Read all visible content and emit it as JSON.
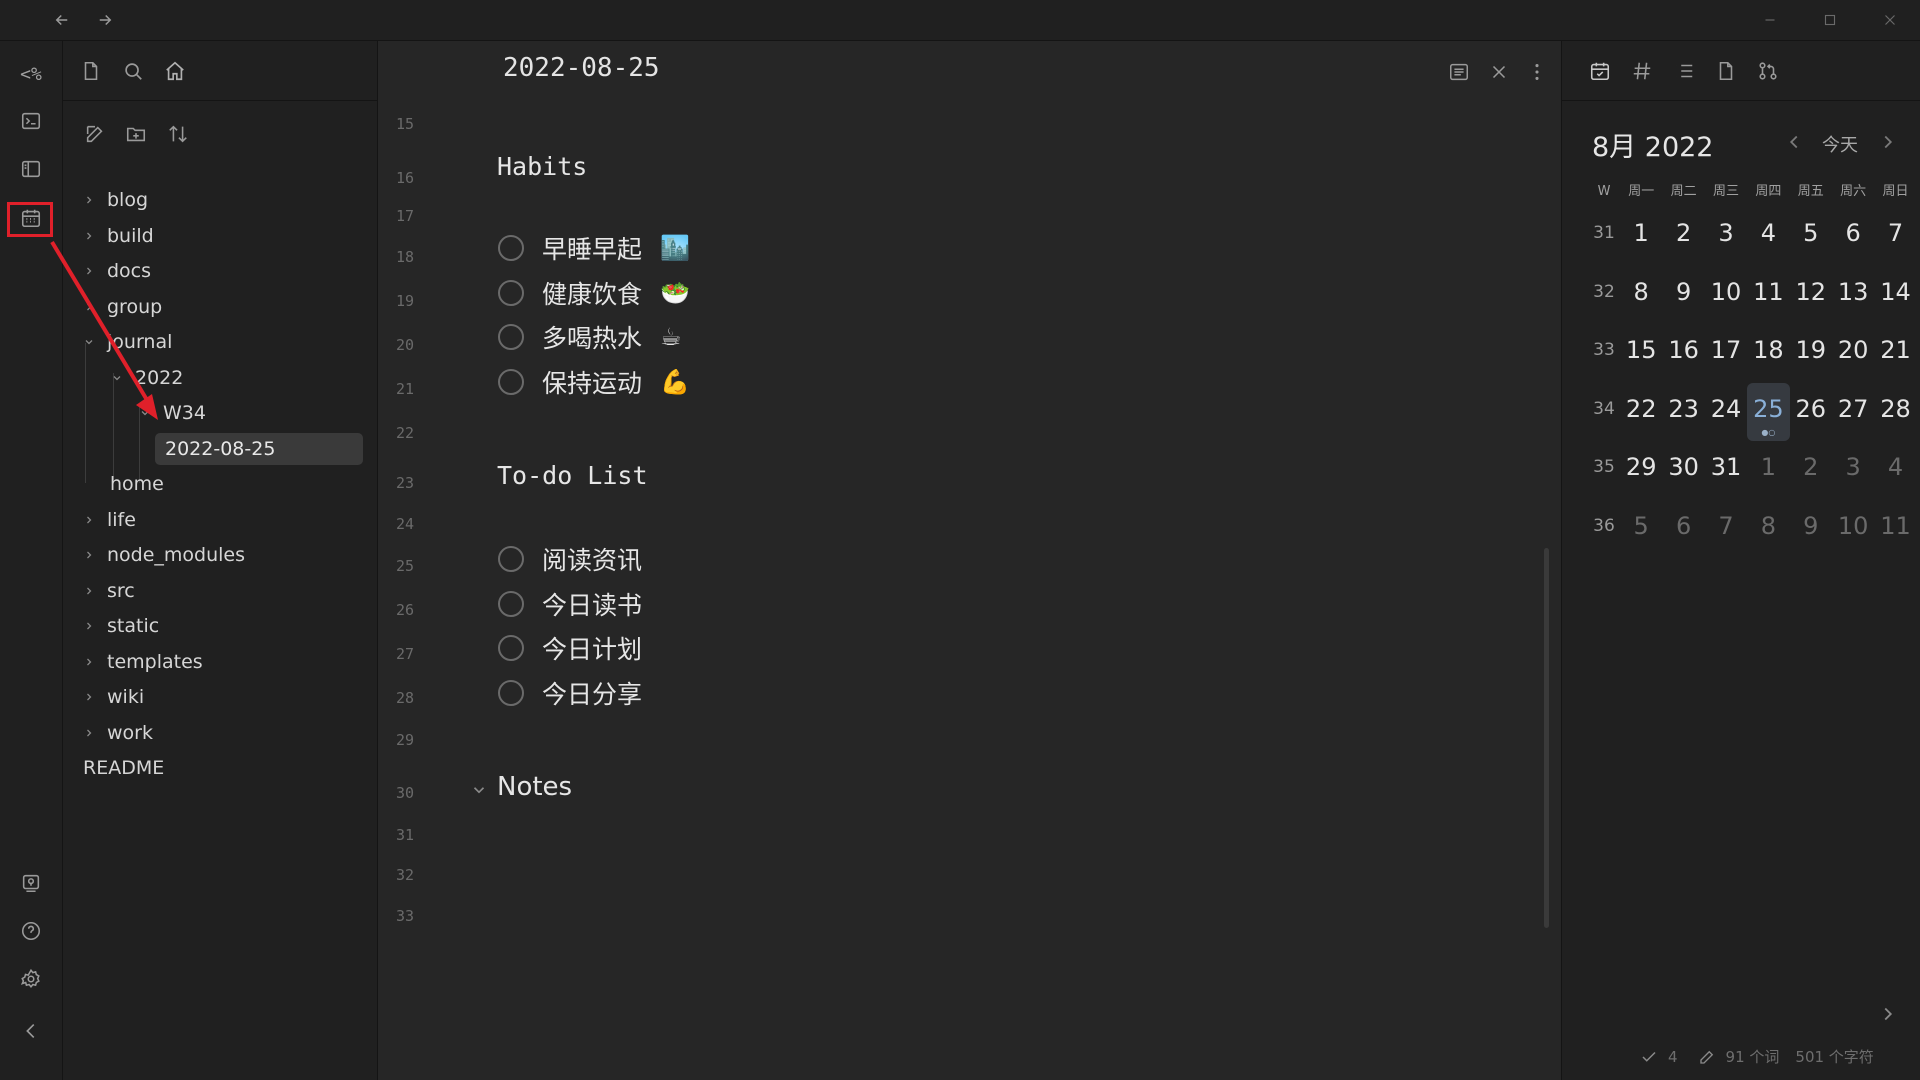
{
  "ribbon": {
    "logo_text": "<%",
    "icons": [
      "terminal-icon",
      "sidebar-layout-icon",
      "calendar-icon",
      "vault-icon",
      "help-icon",
      "settings-icon",
      "collapse-left-icon"
    ]
  },
  "explorer": {
    "tree": [
      {
        "label": "blog",
        "expandable": true,
        "expanded": false
      },
      {
        "label": "build",
        "expandable": true,
        "expanded": false
      },
      {
        "label": "docs",
        "expandable": true,
        "expanded": false
      },
      {
        "label": "group",
        "expandable": true,
        "expanded": false
      },
      {
        "label": "journal",
        "expandable": true,
        "expanded": true
      },
      {
        "label": "2022",
        "expandable": true,
        "expanded": true
      },
      {
        "label": "W34",
        "expandable": true,
        "expanded": true
      },
      {
        "label": "2022-08-25",
        "expandable": false,
        "active": true
      },
      {
        "label": "home",
        "expandable": false
      },
      {
        "label": "life",
        "expandable": true,
        "expanded": false
      },
      {
        "label": "node_modules",
        "expandable": true,
        "expanded": false
      },
      {
        "label": "src",
        "expandable": true,
        "expanded": false
      },
      {
        "label": "static",
        "expandable": true,
        "expanded": false
      },
      {
        "label": "templates",
        "expandable": true,
        "expanded": false
      },
      {
        "label": "wiki",
        "expandable": true,
        "expanded": false
      },
      {
        "label": "work",
        "expandable": true,
        "expanded": false
      },
      {
        "label": "README",
        "expandable": false
      }
    ]
  },
  "editor": {
    "title": "2022-08-25",
    "line_numbers": [
      "15",
      "16",
      "17",
      "18",
      "19",
      "20",
      "21",
      "22",
      "23",
      "24",
      "25",
      "26",
      "27",
      "28",
      "29",
      "30",
      "31",
      "32",
      "33"
    ],
    "habits_heading": "Habits",
    "habits": [
      {
        "label": "早睡早起",
        "emoji": "🏙️"
      },
      {
        "label": "健康饮食",
        "emoji": "🥗"
      },
      {
        "label": "多喝热水",
        "emoji": "☕"
      },
      {
        "label": "保持运动",
        "emoji": "💪"
      }
    ],
    "todo_heading": "To-do List",
    "todos": [
      {
        "label": "阅读资讯"
      },
      {
        "label": "今日读书"
      },
      {
        "label": "今日计划"
      },
      {
        "label": "今日分享"
      }
    ],
    "notes_heading": "Notes"
  },
  "calendar": {
    "month_title": "8月 2022",
    "today_label": "今天",
    "headers": [
      "W",
      "周一",
      "周二",
      "周三",
      "周四",
      "周五",
      "周六",
      "周日"
    ],
    "weeks": [
      {
        "wk": "31",
        "days": [
          "1",
          "2",
          "3",
          "4",
          "5",
          "6",
          "7"
        ],
        "other": []
      },
      {
        "wk": "32",
        "days": [
          "8",
          "9",
          "10",
          "11",
          "12",
          "13",
          "14"
        ],
        "other": []
      },
      {
        "wk": "33",
        "days": [
          "15",
          "16",
          "17",
          "18",
          "19",
          "20",
          "21"
        ],
        "other": []
      },
      {
        "wk": "34",
        "days": [
          "22",
          "23",
          "24",
          "25",
          "26",
          "27",
          "28"
        ],
        "other": [],
        "today_index": 3
      },
      {
        "wk": "35",
        "days": [
          "29",
          "30",
          "31",
          "1",
          "2",
          "3",
          "4"
        ],
        "other": [
          3,
          4,
          5,
          6
        ]
      },
      {
        "wk": "36",
        "days": [
          "5",
          "6",
          "7",
          "8",
          "9",
          "10",
          "11"
        ],
        "other": [
          0,
          1,
          2,
          3,
          4,
          5,
          6
        ]
      }
    ],
    "today_dots": "●○"
  },
  "status": {
    "tasks": "4",
    "words": "91 个词",
    "chars": "501 个字符"
  },
  "colors": {
    "annotation": "#e0202a",
    "today_text": "#8ab0d8"
  }
}
